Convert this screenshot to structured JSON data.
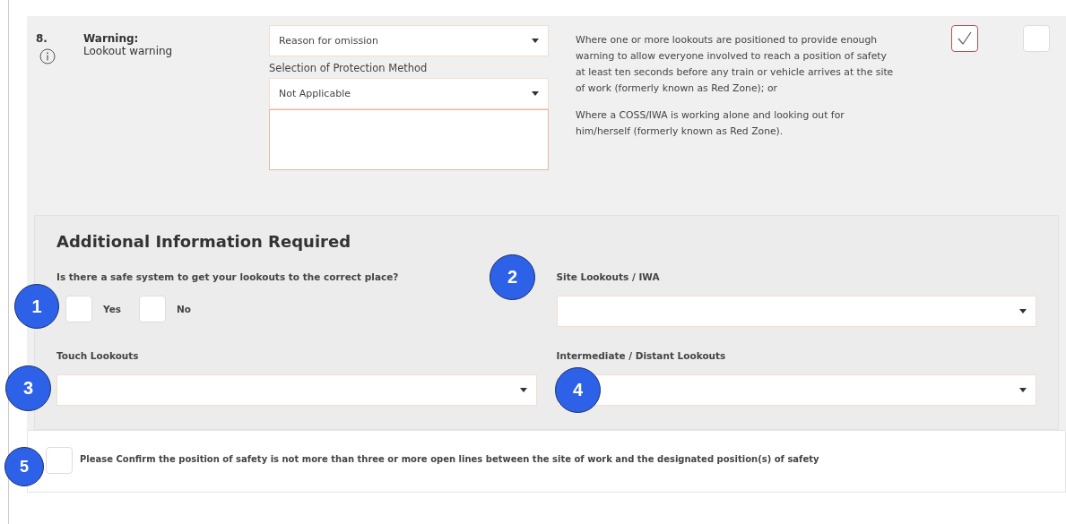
{
  "item": {
    "number": "8.",
    "title": "Warning:",
    "subtitle": "Lookout warning",
    "reason": {
      "placeholder": "Reason for omission"
    },
    "method_label": "Selection of Protection Method",
    "method": {
      "value": "Not Applicable"
    },
    "description": [
      "Where one or more lookouts are positioned to provide enough warning to allow everyone involved to reach a position of safety at least ten seconds before any train or vehicle arrives at the site of work (formerly known as Red Zone); or",
      "Where a COSS/IWA is working alone and looking out for him/herself (formerly known as Red Zone)."
    ],
    "checks": [
      {
        "checked": true
      },
      {
        "checked": false
      }
    ]
  },
  "additional": {
    "heading": "Additional Information Required",
    "question": "Is there a safe system to get your lookouts to the correct place?",
    "options": [
      {
        "label": "Yes",
        "checked": false
      },
      {
        "label": "No",
        "checked": false
      }
    ],
    "fields": [
      {
        "label": "Site Lookouts / IWA"
      },
      {
        "label": "Touch Lookouts"
      },
      {
        "label": "Intermediate / Distant Lookouts"
      }
    ]
  },
  "confirm": {
    "label": "Please Confirm the position of safety is not more than three or more open lines between the site of work and the designated position(s) of safety",
    "checked": false
  },
  "annotations": [
    "1",
    "2",
    "3",
    "4",
    "5"
  ]
}
